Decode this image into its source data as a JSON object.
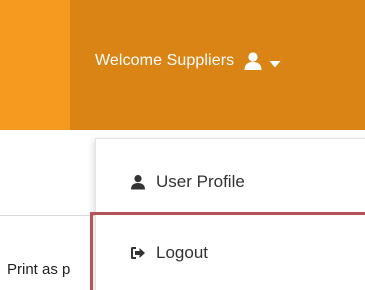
{
  "header": {
    "welcome_text": "Welcome Suppliers",
    "user_icon": "user-icon",
    "caret_icon": "caret-down-icon",
    "colors": {
      "bar": "#db8416",
      "bar_left": "#f59a1f",
      "text": "#ffffff"
    }
  },
  "dropdown": {
    "items": [
      {
        "label": "User Profile",
        "icon": "user-icon"
      },
      {
        "label": "Logout",
        "icon": "sign-out-icon"
      }
    ],
    "highlight_color": "#b5535a"
  },
  "page": {
    "print_text": "Print as p"
  }
}
